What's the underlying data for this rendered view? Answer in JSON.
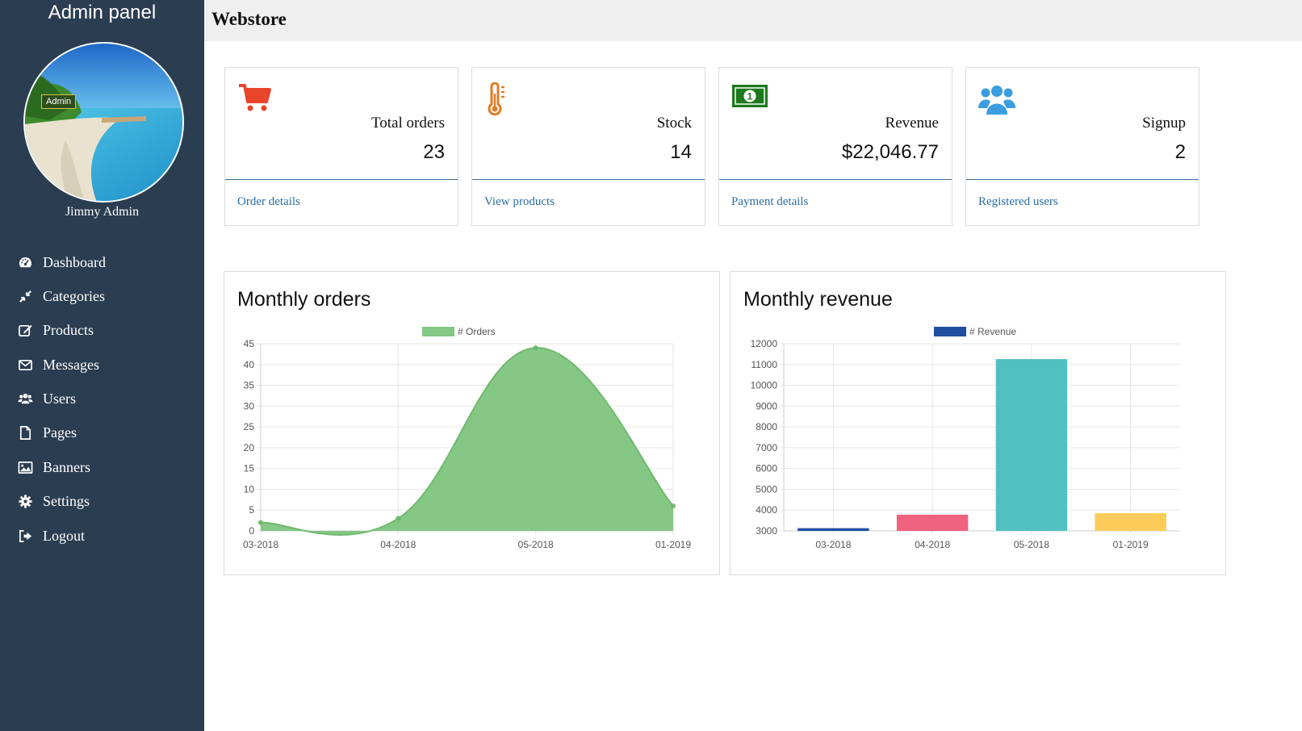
{
  "sidebar": {
    "title": "Admin panel",
    "avatar_badge": "Admin",
    "user_name": "Jimmy Admin",
    "items": [
      {
        "label": "Dashboard",
        "icon": "dashboard-icon"
      },
      {
        "label": "Categories",
        "icon": "compress-icon"
      },
      {
        "label": "Products",
        "icon": "edit-icon"
      },
      {
        "label": "Messages",
        "icon": "envelope-icon"
      },
      {
        "label": "Users",
        "icon": "users-icon"
      },
      {
        "label": "Pages",
        "icon": "file-icon"
      },
      {
        "label": "Banners",
        "icon": "image-icon"
      },
      {
        "label": "Settings",
        "icon": "gear-icon"
      },
      {
        "label": "Logout",
        "icon": "sign-out-icon"
      }
    ],
    "background": "#2b3d51"
  },
  "header": {
    "title": "Webstore"
  },
  "cards": [
    {
      "label": "Total orders",
      "value": "23",
      "link": "Order details",
      "icon": "cart-icon",
      "color": "#e8442a"
    },
    {
      "label": "Stock",
      "value": "14",
      "link": "View products",
      "icon": "thermometer-icon",
      "color": "#e07b25"
    },
    {
      "label": "Revenue",
      "value": "$22,046.77",
      "link": "Payment details",
      "icon": "money-icon",
      "color": "#1f7a1f"
    },
    {
      "label": "Signup",
      "value": "2",
      "link": "Registered users",
      "icon": "users-icon",
      "color": "#3a9de0"
    }
  ],
  "chart_data": [
    {
      "type": "area",
      "title": "Monthly orders",
      "categories": [
        "03-2018",
        "04-2018",
        "05-2018",
        "01-2019"
      ],
      "series": [
        {
          "name": "# Orders",
          "values": [
            2,
            3,
            44,
            6
          ],
          "color": "#85c785"
        }
      ],
      "ylim": [
        0,
        45
      ],
      "yticks": [
        "0",
        "5",
        "10",
        "15",
        "20",
        "25",
        "30",
        "35",
        "40",
        "45"
      ],
      "grid": true,
      "legend": "top"
    },
    {
      "type": "bar",
      "title": "Monthly revenue",
      "categories": [
        "03-2018",
        "04-2018",
        "05-2018",
        "01-2019"
      ],
      "series": [
        {
          "name": "# Revenue",
          "values": [
            3130,
            3780,
            11260,
            3850
          ],
          "color": "#1f4e9e"
        }
      ],
      "bar_colors": [
        "#1f4e9e",
        "#f0637f",
        "#50c0c0",
        "#fdcb5a"
      ],
      "ylim": [
        3000,
        12000
      ],
      "yticks": [
        "3000",
        "4000",
        "5000",
        "6000",
        "7000",
        "8000",
        "9000",
        "10000",
        "11000",
        "12000"
      ],
      "grid": true,
      "legend": "top"
    }
  ]
}
